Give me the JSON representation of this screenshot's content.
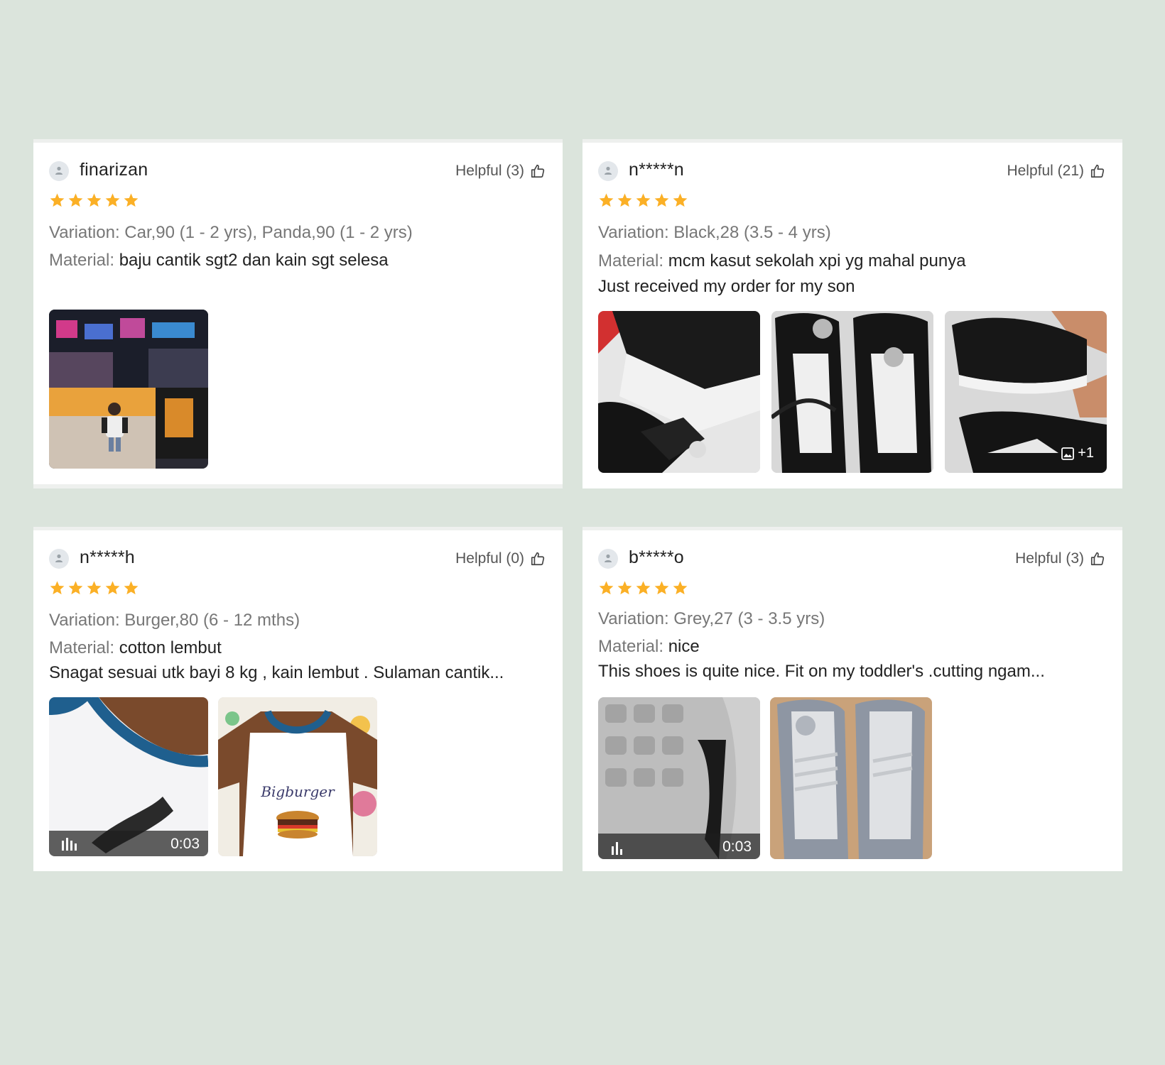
{
  "reviews": [
    {
      "username": "finarizan",
      "helpful": "Helpful (3)",
      "rating": 5,
      "variation_label": "Variation:",
      "variation_value": "Car,90 (1 - 2 yrs), Panda,90 (1 - 2 yrs)",
      "material_label": "Material:",
      "material_value": "baju cantik sgt2 dan kain sgt selesa",
      "comment": "",
      "media": [
        {
          "kind": "photo",
          "subject": "child-in-cinema-lobby"
        }
      ]
    },
    {
      "username": "n*****n",
      "helpful": "Helpful (21)",
      "rating": 5,
      "variation_label": "Variation:",
      "variation_value": "Black,28 (3.5 - 4 yrs)",
      "material_label": "Material:",
      "material_value": "mcm kasut sekolah xpi yg mahal punya",
      "comment": "Just received my order for my son",
      "media": [
        {
          "kind": "photo",
          "subject": "black-shoe-closeup"
        },
        {
          "kind": "photo",
          "subject": "black-shoes-pair"
        },
        {
          "kind": "photo",
          "subject": "shoes-worn",
          "more": "+1"
        }
      ]
    },
    {
      "username": "n*****h",
      "helpful": "Helpful (0)",
      "rating": 5,
      "variation_label": "Variation:",
      "variation_value": "Burger,80 (6 - 12 mths)",
      "material_label": "Material:",
      "material_value": "cotton lembut",
      "comment": "Snagat sesuai utk bayi 8 kg , kain lembut . Sulaman cantik...",
      "media": [
        {
          "kind": "video",
          "duration": "0:03",
          "subject": "shirt-closeup"
        },
        {
          "kind": "photo",
          "subject": "burger-shirt"
        }
      ]
    },
    {
      "username": "b*****o",
      "helpful": "Helpful (3)",
      "rating": 5,
      "variation_label": "Variation:",
      "variation_value": "Grey,27 (3 - 3.5 yrs)",
      "material_label": "Material:",
      "material_value": "nice",
      "comment": "This shoes is quite nice. Fit on my toddler's .cutting ngam...",
      "media": [
        {
          "kind": "video",
          "duration": "0:03",
          "subject": "shoe-sole"
        },
        {
          "kind": "photo",
          "subject": "grey-shoes-pair"
        }
      ]
    }
  ],
  "colors": {
    "background": "#dbe4dc",
    "card": "#ffffff",
    "star": "#fbb026",
    "muted_text": "#777777"
  }
}
